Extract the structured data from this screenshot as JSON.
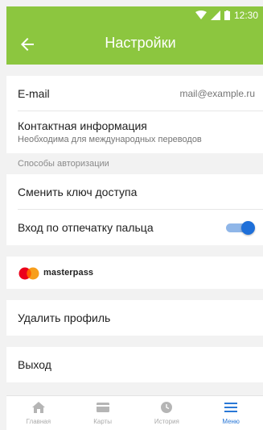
{
  "status": {
    "time": "12:30"
  },
  "header": {
    "title": "Настройки"
  },
  "email": {
    "label": "E-mail",
    "value": "mail@example.ru"
  },
  "contact": {
    "title": "Контактная информация",
    "subtitle": "Необходима для международных переводов"
  },
  "auth_section": {
    "header": "Способы авторизации",
    "change_key": "Сменить ключ доступа",
    "fingerprint": {
      "label": "Вход по отпечатку пальца",
      "enabled": true
    }
  },
  "masterpass": {
    "label": "masterpass"
  },
  "delete_profile": "Удалить профиль",
  "logout": "Выход",
  "bottom_nav": [
    {
      "label": "Главная",
      "icon": "home-icon"
    },
    {
      "label": "Карты",
      "icon": "card-icon"
    },
    {
      "label": "История",
      "icon": "clock-icon"
    },
    {
      "label": "Меню",
      "icon": "menu-icon",
      "active": true
    }
  ],
  "colors": {
    "accent": "#8cc63f",
    "toggle": "#1e6fd9",
    "nav_active": "#2a78d6"
  }
}
